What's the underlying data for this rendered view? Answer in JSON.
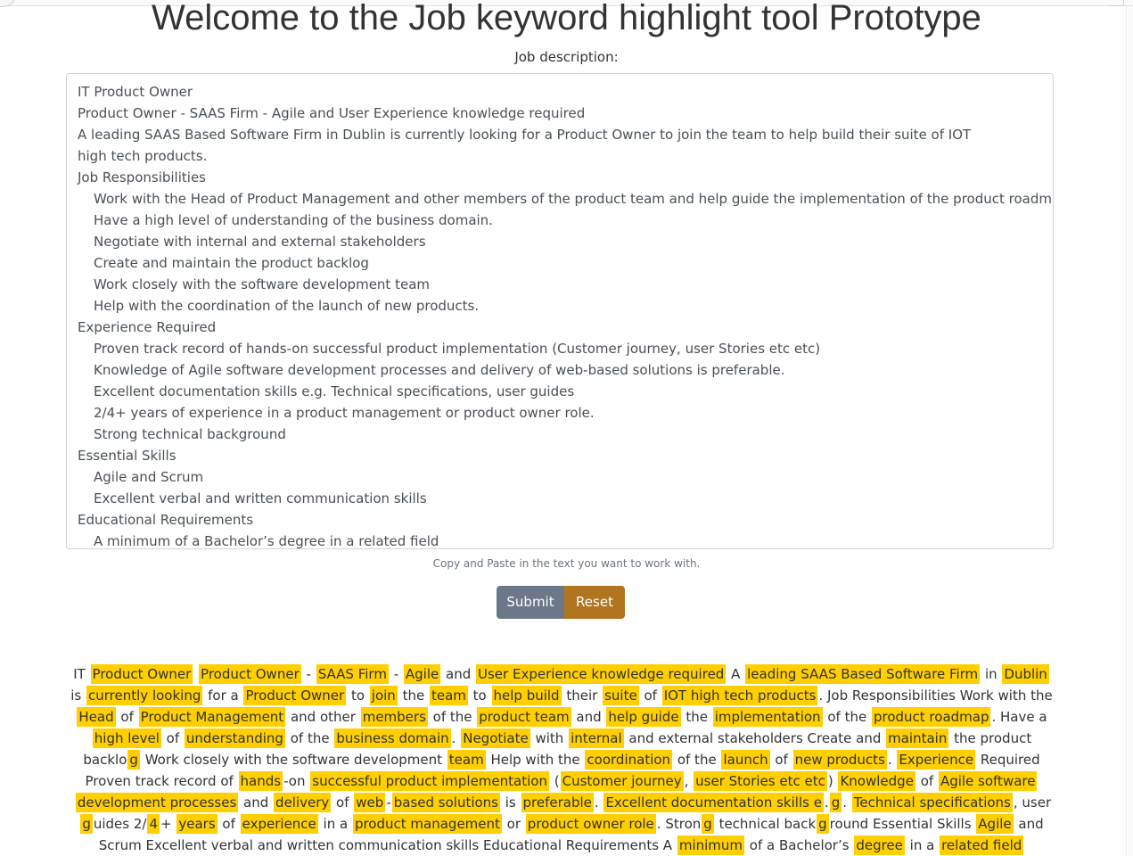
{
  "page": {
    "title": "Welcome to the Job keyword highlight tool Prototype",
    "job_description_label": "Job description:",
    "help_text": "Copy and Paste in the text you want to work with."
  },
  "textarea": {
    "lines": [
      {
        "text": "IT Product Owner",
        "indent": false
      },
      {
        "text": "Product Owner - SAAS Firm - Agile and User Experience knowledge required",
        "indent": false
      },
      {
        "text": "A leading SAAS Based Software Firm in Dublin is currently looking for a Product Owner to join the team to help build their suite of IOT high tech products.",
        "indent": false,
        "wrap": true
      },
      {
        "text": "Job Responsibilities",
        "indent": false
      },
      {
        "text": "Work with the Head of Product Management and other members of the product team and help guide the implementation of the product roadmap.",
        "indent": true
      },
      {
        "text": "Have a high level of understanding of the business domain.",
        "indent": true
      },
      {
        "text": "Negotiate with internal and external stakeholders",
        "indent": true
      },
      {
        "text": "Create and maintain the product backlog",
        "indent": true
      },
      {
        "text": "Work closely with the software development team",
        "indent": true
      },
      {
        "text": "Help with the coordination of the launch of new products.",
        "indent": true
      },
      {
        "text": "Experience Required",
        "indent": false
      },
      {
        "text": "Proven track record of hands-on successful product implementation (Customer journey, user Stories etc etc)",
        "indent": true
      },
      {
        "text": "Knowledge of Agile software development processes and delivery of web-based solutions is preferable.",
        "indent": true
      },
      {
        "text": "Excellent documentation skills e.g. Technical specifications, user guides",
        "indent": true
      },
      {
        "text": "2/4+ years of experience in a product management or product owner role.",
        "indent": true
      },
      {
        "text": "Strong technical background",
        "indent": true
      },
      {
        "text": "Essential Skills",
        "indent": false
      },
      {
        "text": "Agile and Scrum",
        "indent": true
      },
      {
        "text": "Excellent verbal and written communication skills",
        "indent": true
      },
      {
        "text": "Educational Requirements",
        "indent": false
      },
      {
        "text": "A minimum of a Bachelor’s degree in a related field",
        "indent": true
      }
    ]
  },
  "buttons": {
    "submit_label": "Submit",
    "reset_label": "Reset",
    "submit_color": "#6c7889",
    "reset_color": "#b1741f"
  },
  "highlight_color": "#ffcf00",
  "output": {
    "segments": [
      {
        "t": "IT ",
        "h": false
      },
      {
        "t": "Product Owner",
        "h": true
      },
      {
        "t": " ",
        "h": false
      },
      {
        "t": "Product Owner",
        "h": true
      },
      {
        "t": " - ",
        "h": false
      },
      {
        "t": "SAAS Firm",
        "h": true
      },
      {
        "t": " - ",
        "h": false
      },
      {
        "t": "Agile",
        "h": true
      },
      {
        "t": " and ",
        "h": false
      },
      {
        "t": "User Experience knowledge required",
        "h": true
      },
      {
        "t": " A ",
        "h": false
      },
      {
        "t": "leading SAAS Based Software Firm",
        "h": true
      },
      {
        "t": " in ",
        "h": false
      },
      {
        "t": "Dublin",
        "h": true
      },
      {
        "t": " is ",
        "h": false
      },
      {
        "t": "currently looking",
        "h": true
      },
      {
        "t": " for a ",
        "h": false
      },
      {
        "t": "Product Owner",
        "h": true
      },
      {
        "t": " to ",
        "h": false
      },
      {
        "t": "join",
        "h": true
      },
      {
        "t": " the ",
        "h": false
      },
      {
        "t": "team",
        "h": true
      },
      {
        "t": " to ",
        "h": false
      },
      {
        "t": "help build",
        "h": true
      },
      {
        "t": " their ",
        "h": false
      },
      {
        "t": "suite",
        "h": true
      },
      {
        "t": " of ",
        "h": false
      },
      {
        "t": "IOT high tech products",
        "h": true
      },
      {
        "t": ". Job Responsibilities Work with the ",
        "h": false
      },
      {
        "t": "Head",
        "h": true
      },
      {
        "t": " of ",
        "h": false
      },
      {
        "t": "Product Management",
        "h": true
      },
      {
        "t": " and other ",
        "h": false
      },
      {
        "t": "members",
        "h": true
      },
      {
        "t": " of the ",
        "h": false
      },
      {
        "t": "product team",
        "h": true
      },
      {
        "t": " and ",
        "h": false
      },
      {
        "t": "help guide",
        "h": true
      },
      {
        "t": " the ",
        "h": false
      },
      {
        "t": "implementation",
        "h": true
      },
      {
        "t": " of the ",
        "h": false
      },
      {
        "t": "product roadmap",
        "h": true
      },
      {
        "t": ". Have a ",
        "h": false
      },
      {
        "t": "high level",
        "h": true
      },
      {
        "t": " of ",
        "h": false
      },
      {
        "t": "understanding",
        "h": true
      },
      {
        "t": " of the ",
        "h": false
      },
      {
        "t": "business domain",
        "h": true
      },
      {
        "t": ". ",
        "h": false
      },
      {
        "t": "Negotiate",
        "h": true
      },
      {
        "t": " with ",
        "h": false
      },
      {
        "t": "internal",
        "h": true
      },
      {
        "t": " and external stakeholders Create and ",
        "h": false
      },
      {
        "t": "maintain",
        "h": true
      },
      {
        "t": " the product backlo",
        "h": false
      },
      {
        "t": "g",
        "h": true
      },
      {
        "t": " Work closely with the software development ",
        "h": false
      },
      {
        "t": "team",
        "h": true
      },
      {
        "t": " Help with the ",
        "h": false
      },
      {
        "t": "coordination",
        "h": true
      },
      {
        "t": " of the ",
        "h": false
      },
      {
        "t": "launch",
        "h": true
      },
      {
        "t": " of ",
        "h": false
      },
      {
        "t": "new products",
        "h": true
      },
      {
        "t": ". ",
        "h": false
      },
      {
        "t": "Experience",
        "h": true
      },
      {
        "t": " Required Proven track record of ",
        "h": false
      },
      {
        "t": "hands",
        "h": true
      },
      {
        "t": "-on ",
        "h": false
      },
      {
        "t": "successful product implementation",
        "h": true
      },
      {
        "t": " (",
        "h": false
      },
      {
        "t": "Customer journey",
        "h": true
      },
      {
        "t": ", ",
        "h": false
      },
      {
        "t": "user Stories etc etc",
        "h": true
      },
      {
        "t": ") ",
        "h": false
      },
      {
        "t": "Knowledge",
        "h": true
      },
      {
        "t": " of ",
        "h": false
      },
      {
        "t": "Agile software development processes",
        "h": true
      },
      {
        "t": " and ",
        "h": false
      },
      {
        "t": "delivery",
        "h": true
      },
      {
        "t": " of ",
        "h": false
      },
      {
        "t": "web",
        "h": true
      },
      {
        "t": "-",
        "h": false
      },
      {
        "t": "based solutions",
        "h": true
      },
      {
        "t": " is ",
        "h": false
      },
      {
        "t": "preferable",
        "h": true
      },
      {
        "t": ". ",
        "h": false
      },
      {
        "t": "Excellent documentation skills e",
        "h": true
      },
      {
        "t": ".",
        "h": false
      },
      {
        "t": "g",
        "h": true
      },
      {
        "t": ". ",
        "h": false
      },
      {
        "t": "Technical specifications",
        "h": true
      },
      {
        "t": ", user ",
        "h": false
      },
      {
        "t": "g",
        "h": true
      },
      {
        "t": "uides 2/",
        "h": false
      },
      {
        "t": "4",
        "h": true
      },
      {
        "t": "+ ",
        "h": false
      },
      {
        "t": "years",
        "h": true
      },
      {
        "t": " of ",
        "h": false
      },
      {
        "t": "experience",
        "h": true
      },
      {
        "t": " in a ",
        "h": false
      },
      {
        "t": "product management",
        "h": true
      },
      {
        "t": " or ",
        "h": false
      },
      {
        "t": "product owner role",
        "h": true
      },
      {
        "t": ". Stron",
        "h": false
      },
      {
        "t": "g",
        "h": true
      },
      {
        "t": " technical back",
        "h": false
      },
      {
        "t": "g",
        "h": true
      },
      {
        "t": "round Essential Skills ",
        "h": false
      },
      {
        "t": "Agile",
        "h": true
      },
      {
        "t": " and Scrum Excellent verbal and written communication skills Educational Requirements A ",
        "h": false
      },
      {
        "t": "minimum",
        "h": true
      },
      {
        "t": " of a Bachelor’s ",
        "h": false
      },
      {
        "t": "degree",
        "h": true
      },
      {
        "t": " in a ",
        "h": false
      },
      {
        "t": "related field",
        "h": true
      }
    ]
  }
}
